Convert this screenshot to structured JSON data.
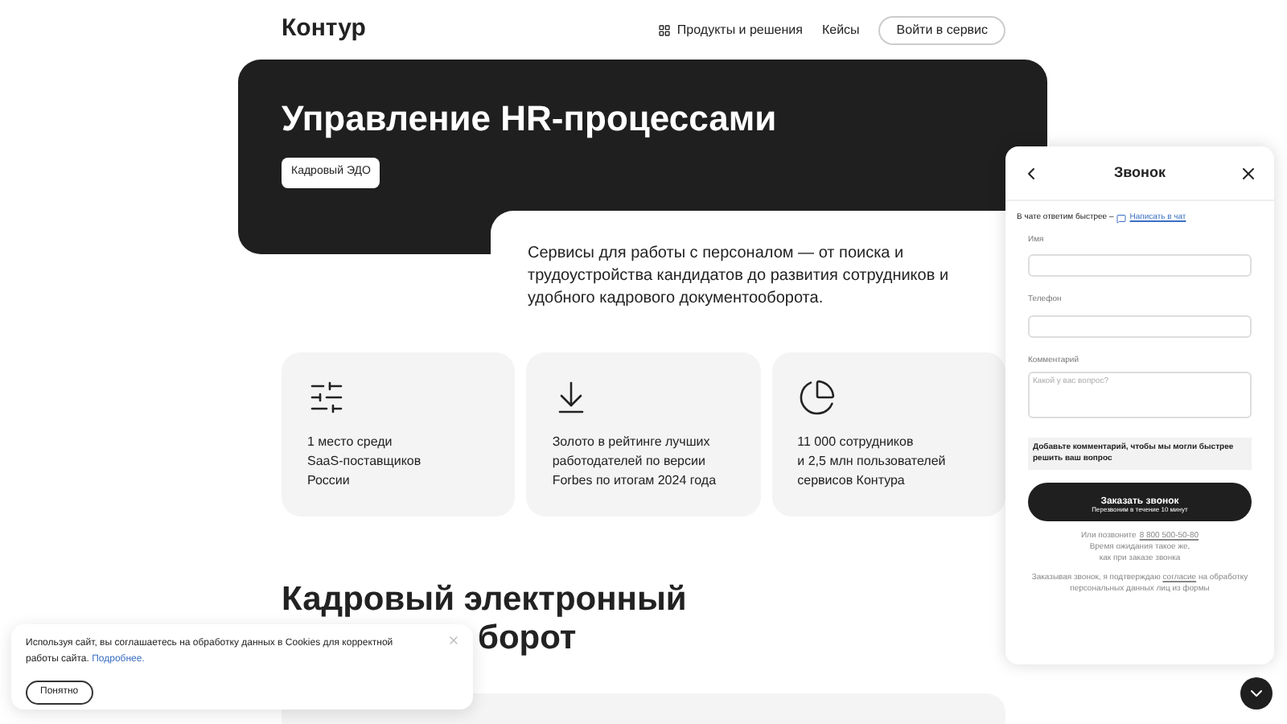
{
  "header": {
    "logo": "Контур",
    "nav": [
      {
        "label": "Продукты и решения",
        "kind": "grid"
      },
      {
        "label": "Кейсы",
        "kind": "plain"
      }
    ],
    "login_button": "Войти в сервис"
  },
  "hero": {
    "title": "Управление HR-процессами",
    "badge": "Кадровый ЭДО",
    "description": "Сервисы для работы с персоналом — от поиска и трудоустройства кандидатов до развития сотрудников и удобного кадрового документооборота."
  },
  "facts": [
    {
      "kind": "sliders",
      "lines": [
        "1 место среди",
        "SaaS-поставщиков",
        "России"
      ]
    },
    {
      "kind": "download",
      "lines": [
        "Золото в рейтинге лучших",
        "работодателей по версии",
        "Forbes по итогам 2024 года"
      ]
    },
    {
      "kind": "pie",
      "lines": [
        "11 000 сотрудников",
        "и 2,5 млн пользователей",
        "сервисов Контура"
      ]
    }
  ],
  "section": {
    "title_lines": [
      "Кадровый электронный",
      "борот"
    ]
  },
  "call_panel": {
    "title": "Звонок",
    "chat_note": "В чате ответим быстрее –",
    "chat_link": "Написать в чат",
    "fields": [
      {
        "label": "Имя",
        "kind": "input"
      },
      {
        "label": "Телефон",
        "kind": "input"
      },
      {
        "label": "Комментарий",
        "kind": "textarea",
        "placeholder": "Какой у вас вопрос?"
      }
    ],
    "hint": "Добавьте комментарий, чтобы мы могли быстрее решить ваш вопрос",
    "submit": "Заказать звонок",
    "submit_sub": "Перезвоним в течение 10 минут",
    "phone_prefix": "Или позвоните",
    "phone": "8 800 500-50-80",
    "wait_lines": [
      "Время ожидания такое же,",
      "как при заказе звонка"
    ],
    "consent_before": "Заказывая звонок, я подтверждаю",
    "consent_link": "согласие",
    "consent_after": "на обработку персональных данных лиц из формы"
  },
  "cookie": {
    "text": "Используя сайт, вы соглашаетесь на обработку данных в Cookies для корректной работы сайта.",
    "link": "Подробнее.",
    "button": "Понятно"
  }
}
